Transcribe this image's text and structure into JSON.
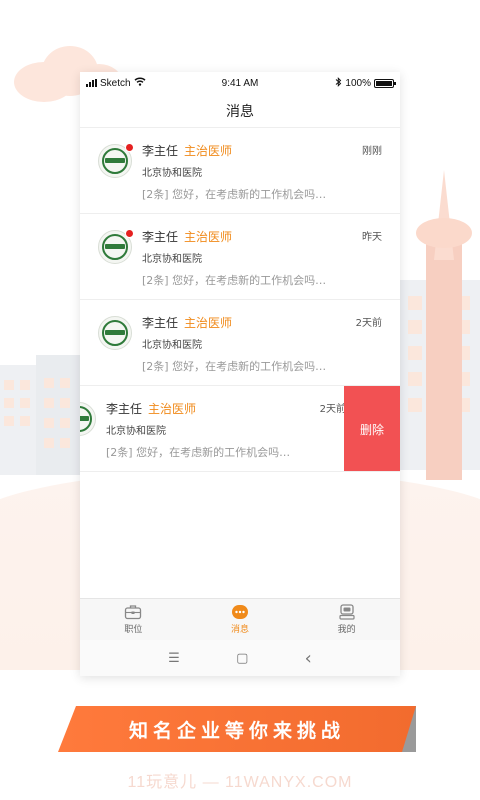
{
  "status_bar": {
    "carrier": "Sketch",
    "time": "9:41 AM",
    "battery": "100%"
  },
  "nav": {
    "title": "消息"
  },
  "messages": [
    {
      "name": "李主任",
      "title": "主治医师",
      "hospital": "北京协和医院",
      "preview": "[2条] 您好，在考虑新的工作机会吗…",
      "time": "刚刚",
      "unread": true
    },
    {
      "name": "李主任",
      "title": "主治医师",
      "hospital": "北京协和医院",
      "preview": "[2条] 您好，在考虑新的工作机会吗…",
      "time": "昨天",
      "unread": true
    },
    {
      "name": "李主任",
      "title": "主治医师",
      "hospital": "北京协和医院",
      "preview": "[2条] 您好，在考虑新的工作机会吗…",
      "time": "2天前",
      "unread": false
    },
    {
      "name": "李主任",
      "title": "主治医师",
      "hospital": "北京协和医院",
      "preview": "[2条] 您好，在考虑新的工作机会吗…",
      "time": "2天前",
      "unread": false
    }
  ],
  "delete_label": "删除",
  "tabs": [
    {
      "label": "职位",
      "icon": "briefcase-icon"
    },
    {
      "label": "消息",
      "icon": "message-icon",
      "active": true
    },
    {
      "label": "我的",
      "icon": "profile-icon"
    }
  ],
  "system_nav": {
    "menu": "☰",
    "home": "▢",
    "back": "‹"
  },
  "banner": {
    "text": "知名企业等你来挑战"
  },
  "watermark": "11玩意儿 — 11WANYX.COM",
  "colors": {
    "accent": "#f08a1a",
    "delete": "#f25153",
    "banner": "#ff7a3c",
    "unread_dot": "#e52020"
  }
}
